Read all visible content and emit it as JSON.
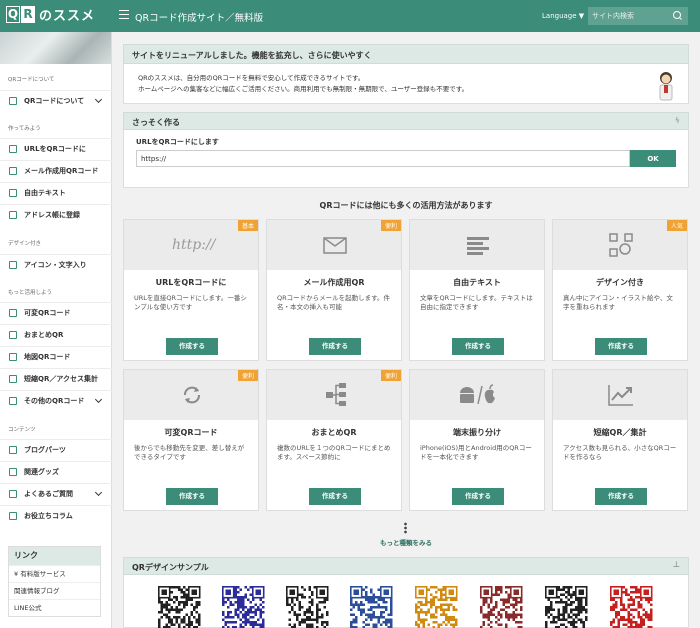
{
  "header": {
    "logo_q": "Q",
    "logo_r": "R",
    "logo_text": "のススメ",
    "site_title": "QRコード作成サイト／無料版",
    "language": "Language ▼",
    "search_placeholder": "サイト内検索"
  },
  "sidebar": {
    "sections": [
      "QRコードについて",
      "作ってみよう",
      "デザイン付き",
      "もっと活用しよう",
      "コンテンツ"
    ],
    "items": [
      {
        "label": "QRコードについて",
        "chev": true
      },
      {
        "label": "URLをQRコードに",
        "chev": false
      },
      {
        "label": "メール作成用QRコード",
        "chev": false
      },
      {
        "label": "自由テキスト",
        "chev": false
      },
      {
        "label": "アドレス帳に登録",
        "chev": false
      },
      {
        "label": "アイコン・文字入り",
        "chev": false
      },
      {
        "label": "可変QRコード",
        "chev": false
      },
      {
        "label": "おまとめQR",
        "chev": false
      },
      {
        "label": "地図QRコード",
        "chev": false
      },
      {
        "label": "短縮QR／アクセス集計",
        "chev": false
      },
      {
        "label": "その他のQRコード",
        "chev": true
      },
      {
        "label": "ブログパーツ",
        "chev": false
      },
      {
        "label": "関連グッズ",
        "chev": false
      },
      {
        "label": "よくあるご質問",
        "chev": true
      },
      {
        "label": "お役立ちコラム",
        "chev": false
      }
    ],
    "links_title": "リンク",
    "links": [
      "¥ 有料版サービス",
      "関連情報ブログ",
      "LINE公式"
    ]
  },
  "notice": {
    "title": "サイトをリニューアルしました。機能を拡充し、さらに使いやすく",
    "line1": "QRのススメは、自分用のQRコードを無料で安心して作成できるサイトです。",
    "line2": "ホームページへの集客などに幅広くご活用ください。商用利用でも無制限・無期限で、ユーザー登録も不要です。"
  },
  "quick": {
    "title": "さっそく作る",
    "label": "URLをQRコードにします",
    "input_value": "https://",
    "ok": "OK"
  },
  "features": {
    "heading": "QRコードには他にも多くの活用方法があります",
    "make_label": "作成する",
    "cards": [
      {
        "title": "URLをQRコードに",
        "desc": "URLを直接QRコードにします。一番シンプルな使い方です",
        "badge": "基本",
        "icon_text": "http://"
      },
      {
        "title": "メール作成用QR",
        "desc": "QRコードからメールを起動します。件名・本文の挿入も可能",
        "badge": "便利",
        "icon_text": ""
      },
      {
        "title": "自由テキスト",
        "desc": "文章をQRコードにします。テキストは自由に指定できます",
        "badge": "",
        "icon_text": ""
      },
      {
        "title": "デザイン付き",
        "desc": "真ん中にアイコン・イラスト絵や、文字を重ねられます",
        "badge": "人気",
        "icon_text": ""
      },
      {
        "title": "可変QRコード",
        "desc": "後からでも移動先を変更、差し替えができるタイプです",
        "badge": "便利",
        "icon_text": ""
      },
      {
        "title": "おまとめQR",
        "desc": "複数のURLを１つのQRコードにまとめます。スペース節約に",
        "badge": "便利",
        "icon_text": ""
      },
      {
        "title": "端末振り分け",
        "desc": "iPhone(iOS)用とAndroid用のQRコードを一本化できます",
        "badge": "",
        "icon_text": ""
      },
      {
        "title": "短縮QR／集計",
        "desc": "アクセス数も見られる、小さなQRコードを作るなら",
        "badge": "",
        "icon_text": ""
      }
    ],
    "more": "もっと種類をみる"
  },
  "samples": {
    "title": "QRデザインサンプル",
    "colors": [
      "#222222",
      "#2b2b9a",
      "#222222",
      "#2b4e9a",
      "#d08a10",
      "#8a2b2b",
      "#222222",
      "#c42020"
    ]
  },
  "colors": {
    "accent": "#3b8c78",
    "badge": "#f0a232",
    "panel_header": "#dde9e4"
  }
}
